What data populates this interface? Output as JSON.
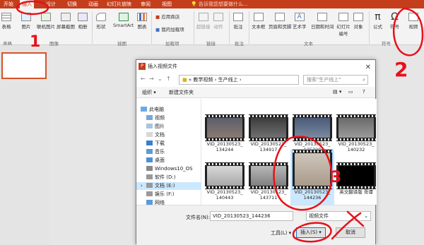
{
  "ribbon_tabs": [
    "开始",
    "插入",
    "设计",
    "切换",
    "动画",
    "幻灯片放映",
    "审阅",
    "视图"
  ],
  "tell_me": "告诉我您想要做什么...",
  "ribbon": {
    "table": "表格",
    "picture": "图片",
    "online_picture": "联机图片",
    "screenshot": "屏幕截图",
    "album": "相册",
    "shapes": "形状",
    "smartart": "SmartArt",
    "chart": "图表",
    "store": "应用商店",
    "my_addins": "我的加载项",
    "hyperlink": "超链接",
    "action": "动作",
    "comment": "批注",
    "textbox": "文本框",
    "header_footer": "页眉和页脚",
    "wordart": "艺术字",
    "datetime": "日期和时间",
    "slide_number": "幻灯片编号",
    "object": "对象",
    "equation": "公式",
    "symbol": "符号",
    "video": "视频",
    "groups": {
      "tables": "表格",
      "images": "图像",
      "illustrations": "插图",
      "addins": "加载项",
      "links": "链接",
      "comments": "批注",
      "text": "文本",
      "symbols": "符号"
    }
  },
  "dialog": {
    "title": "插入视频文件",
    "path_prefix": "«",
    "path": [
      "教学视频",
      "生产线上"
    ],
    "search_placeholder": "搜索\"生产线上\"",
    "organize": "组织 ▾",
    "new_folder": "新建文件夹",
    "tree": [
      "此电脑",
      "视频",
      "图片",
      "文档",
      "下载",
      "音乐",
      "桌面",
      "Windows10_OS",
      "软件 (D:)",
      "文档 (E:)",
      "娱乐 (F:)",
      "网络"
    ],
    "files": [
      {
        "name": "VID_20130523_\n134244"
      },
      {
        "name": "VID_20130523_\n134917"
      },
      {
        "name": "VID_20130523_\n135320"
      },
      {
        "name": "VID_20130523_\n140232"
      },
      {
        "name": "VID_20130523_\n140443"
      },
      {
        "name": "VID_20130523_\n143711"
      },
      {
        "name": "VID_20130523_\n144236"
      },
      {
        "name": "英文翻译版 哥谭"
      }
    ],
    "filename_label": "文件名(N):",
    "filename_value": "VID_20130523_144236",
    "filetype": "视频文件",
    "tools": "工具(L)",
    "insert": "插入(S)",
    "cancel": "取消"
  },
  "annotations": {
    "one": "1",
    "two": "2",
    "three": "3"
  },
  "colors": {
    "accent": "#c43e1c",
    "annotation": "#e8101a",
    "selection": "#cce8ff"
  }
}
